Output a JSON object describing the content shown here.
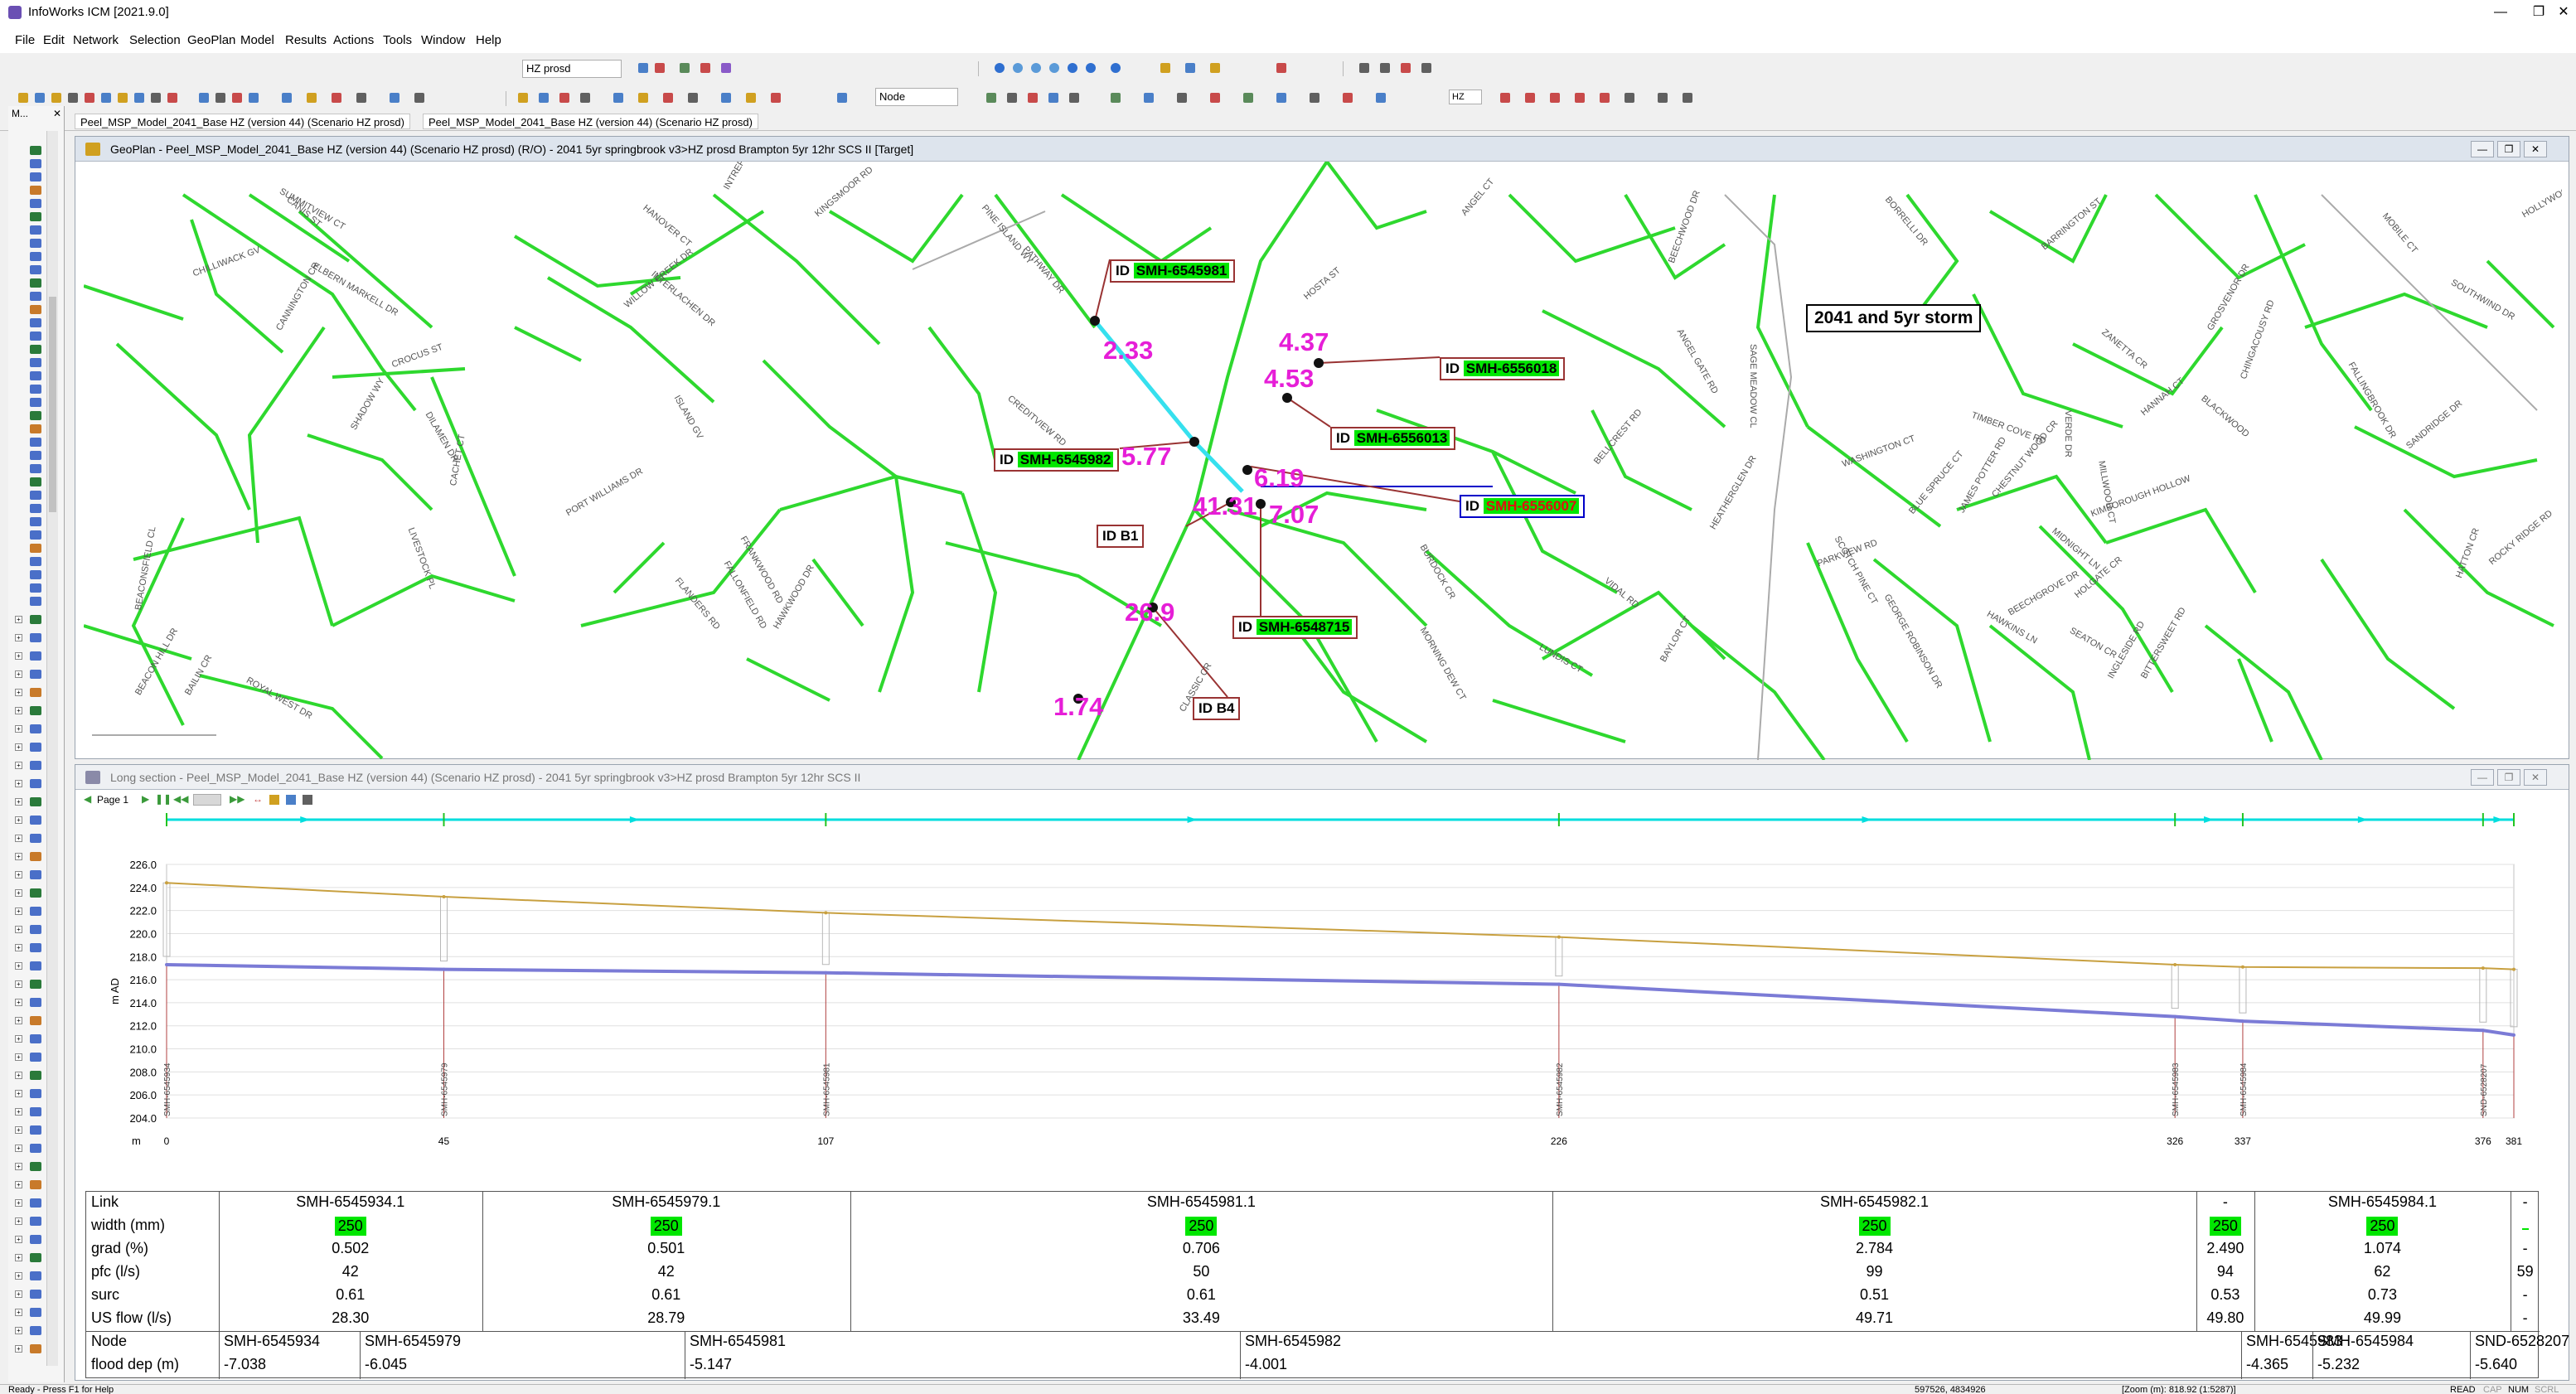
{
  "app_title": "InfoWorks ICM [2021.9.0]",
  "menu": [
    "File",
    "Edit",
    "Network",
    "Selection",
    "GeoPlan",
    "Model",
    "Results",
    "Actions",
    "Tools",
    "Window",
    "Help"
  ],
  "toolbar": {
    "scenario_combo": "HZ prosd",
    "object_combo": "Node",
    "small_combo": "HZ"
  },
  "left_panel_tab": "M...",
  "doc_tabs": [
    "Peel_MSP_Model_2041_Base HZ (version 44) (Scenario HZ prosd)",
    "Peel_MSP_Model_2041_Base HZ (version 44) (Scenario HZ prosd)"
  ],
  "geoplan": {
    "title": "GeoPlan - Peel_MSP_Model_2041_Base HZ (version 44) (Scenario HZ prosd)  (R/O) - 2041 5yr springbrook v3>HZ prosd Brampton 5yr 12hr SCS II  [Target]",
    "storm_label": "2041 and 5yr storm",
    "values": [
      "2.33",
      "4.37",
      "4.53",
      "5.77",
      "6.19",
      "7.07",
      "41.31",
      "26.9",
      "1.74"
    ],
    "labels": [
      {
        "prefix": "ID",
        "id": "SMH-6545981"
      },
      {
        "prefix": "ID",
        "id": "SMH-6556018"
      },
      {
        "prefix": "ID",
        "id": "SMH-6556013"
      },
      {
        "prefix": "ID",
        "id": "SMH-6545982"
      },
      {
        "prefix": "ID",
        "id": "SMH-6556007"
      },
      {
        "prefix": "ID",
        "id": "B1"
      },
      {
        "prefix": "ID",
        "id": "SMH-6548715"
      },
      {
        "prefix": "ID",
        "id": "B4"
      }
    ],
    "streets": [
      "SUMMITVIEW CT",
      "ELBERN MARKELL DR",
      "CHILLIWACK GV",
      "CANIS ST",
      "CANNINGTON CR",
      "SHADOW WY",
      "CROCUS ST",
      "DILAMEN DR",
      "CACHET CT",
      "LIVESTOCK PL",
      "BEACONSFIELD CL",
      "BEACON HILL DR",
      "BAILIN CR",
      "ROYAL WEST DR",
      "HANOVER CT",
      "WILLOW CREEK DR",
      "INTERLACHEN DR",
      "ISLAND GV",
      "PORT WILLIAMS DR",
      "FLANDERS RD",
      "FRANKWOOD RD",
      "FALLONFIELD RD",
      "HAWKWOOD DR",
      "INTREPID TL",
      "KINGSMOOR RD",
      "PINE ISLAND WY",
      "PATHWAY DR",
      "CREDITVIEW RD",
      "HOSTA ST",
      "ANGEL CT",
      "BEECHWOOD DR",
      "ANGEL GATE RD",
      "SAGE MEADOW CL",
      "BORRELLI DR",
      "TIMBER COVE RD",
      "WASHINGTON CT",
      "SCOTCH PINE CT",
      "HAWKINS LN",
      "JAMES POTTER RD",
      "CHESTNUT WOOD CR",
      "MIDNIGHT LN",
      "HOLGATE CR",
      "KIMBOROUGH HOLLOW",
      "INGLESIDE RD",
      "BITTERSWEET RD",
      "BEECHGROVE DR",
      "SEATON CR",
      "BLACKWOOD",
      "VERDE DR",
      "MILLWOOD CT",
      "GEORGE ROBINSON DR",
      "BELLCREST RD",
      "LUNDIS CT",
      "VIDAL RD",
      "HEATHERGLEN DR",
      "BURDOCK CR",
      "MORNING DEW CT",
      "BAYLOR CT",
      "BARRINGTON ST",
      "ZANETTA CR",
      "HANNAH CT",
      "GROSVENOR DR",
      "CHINGACOUSY RD",
      "MOBILE CT",
      "SOUTHWIND DR",
      "HOLLYWOOD CT",
      "FALLINGBROOK DR",
      "SANDRIDGE DR",
      "HATTON CR",
      "ROCKY RIDGE RD",
      "CLASSIC CR",
      "BLUE SPRUCE CT",
      "PARKVIEW RD"
    ]
  },
  "long_section": {
    "title": "Long section - Peel_MSP_Model_2041_Base HZ (version 44) (Scenario HZ prosd) - 2041 5yr springbrook v3>HZ prosd Brampton 5yr 12hr SCS II",
    "page_label": "Page 1"
  },
  "chart_data": {
    "type": "line",
    "title": "",
    "xlabel": "m",
    "ylabel": "m AD",
    "ylim": [
      204.0,
      226.0
    ],
    "yticks": [
      "226.0",
      "224.0",
      "222.0",
      "220.0",
      "218.0",
      "216.0",
      "214.0",
      "212.0",
      "210.0",
      "208.0",
      "206.0",
      "204.0"
    ],
    "xticks": [
      "0",
      "45",
      "107",
      "226",
      "326",
      "337",
      "376",
      "381"
    ],
    "x_values": [
      0,
      45,
      107,
      226,
      326,
      337,
      376,
      381
    ],
    "node_names": [
      "SMH-6545934",
      "SMH-6545979",
      "SMH-6545981",
      "SMH-6545982",
      "SMH-6545983",
      "SMH-6545984",
      "SND-6528207",
      ""
    ],
    "series": [
      {
        "values": [
          224.4,
          223.2,
          221.8,
          219.7,
          217.3,
          217.1,
          217.0,
          216.9
        ]
      },
      {
        "values": [
          217.3,
          216.9,
          216.6,
          215.6,
          212.8,
          212.4,
          211.6,
          211.2
        ]
      }
    ],
    "colors": {
      "ground": "#c8a040",
      "hgl": "#7b7bd6",
      "pipe": "#b04040",
      "grid": "#e0e0e0",
      "top_line": "#00dede"
    }
  },
  "table": {
    "row_labels": [
      "Link",
      "width (mm)",
      "grad (%)",
      "pfc (l/s)",
      "surc",
      "US flow (l/s)",
      "Node",
      "flood dep (m)"
    ],
    "links": [
      {
        "link": "SMH-6545934.1",
        "width": "250",
        "grad": "0.502",
        "pfc": "42",
        "surc": "0.61",
        "flow": "28.30"
      },
      {
        "link": "SMH-6545979.1",
        "width": "250",
        "grad": "0.501",
        "pfc": "42",
        "surc": "0.61",
        "flow": "28.79"
      },
      {
        "link": "SMH-6545981.1",
        "width": "250",
        "grad": "0.706",
        "pfc": "50",
        "surc": "0.61",
        "flow": "33.49"
      },
      {
        "link": "SMH-6545982.1",
        "width": "250",
        "grad": "2.784",
        "pfc": "99",
        "surc": "0.51",
        "flow": "49.71"
      },
      {
        "link": "-",
        "width": "250",
        "grad": "2.490",
        "pfc": "94",
        "surc": "0.53",
        "flow": "49.80"
      },
      {
        "link": "SMH-6545984.1",
        "width": "250",
        "grad": "1.074",
        "pfc": "62",
        "surc": "0.73",
        "flow": "49.99"
      },
      {
        "link": "-",
        "width": "",
        "grad": "-",
        "pfc": "59",
        "surc": "-",
        "flow": "-"
      }
    ],
    "nodes": [
      {
        "node": "SMH-6545934",
        "dep": "-7.038"
      },
      {
        "node": "SMH-6545979",
        "dep": "-6.045"
      },
      {
        "node": "SMH-6545981",
        "dep": "-5.147"
      },
      {
        "node": "SMH-6545982",
        "dep": "-4.001"
      },
      {
        "node": "SMH-6545983",
        "dep": "-4.365"
      },
      {
        "node": "SMH-6545984",
        "dep": "-5.232"
      },
      {
        "node": "SND-6528207",
        "dep": "-5.640"
      }
    ]
  },
  "status": {
    "left": "Ready - Press F1 for Help",
    "coords": "597526, 4834926",
    "zoom": "[Zoom (m): 818.92 (1:5287)]",
    "indicators": [
      "READ",
      "CAP",
      "NUM",
      "SCRL"
    ]
  }
}
